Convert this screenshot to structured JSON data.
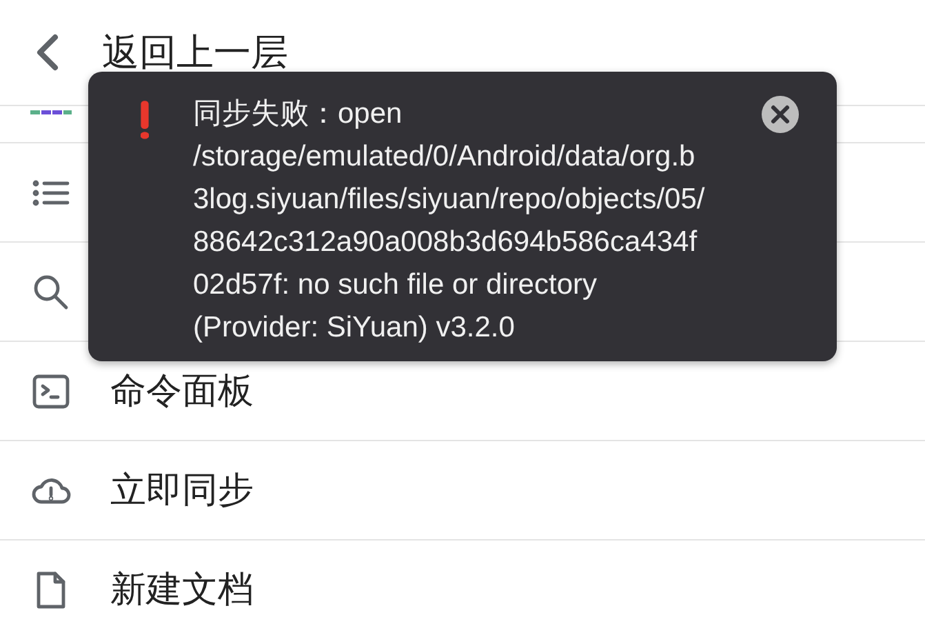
{
  "header": {
    "back_label": "返回上一层"
  },
  "menu_items": [
    {
      "kind": "dashes"
    },
    {
      "kind": "list"
    },
    {
      "kind": "search"
    },
    {
      "kind": "terminal",
      "label": "命令面板"
    },
    {
      "kind": "cloud",
      "label": "立即同步"
    },
    {
      "kind": "file",
      "label": "新建文档"
    }
  ],
  "toast": {
    "message": "同步失败：open /storage/emulated/0/Android/data/org.b3log.siyuan/files/siyuan/repo/objects/05/88642c312a90a008b3d694b586ca434f02d57f: no such file or directory (Provider: SiYuan) v3.2.0"
  }
}
